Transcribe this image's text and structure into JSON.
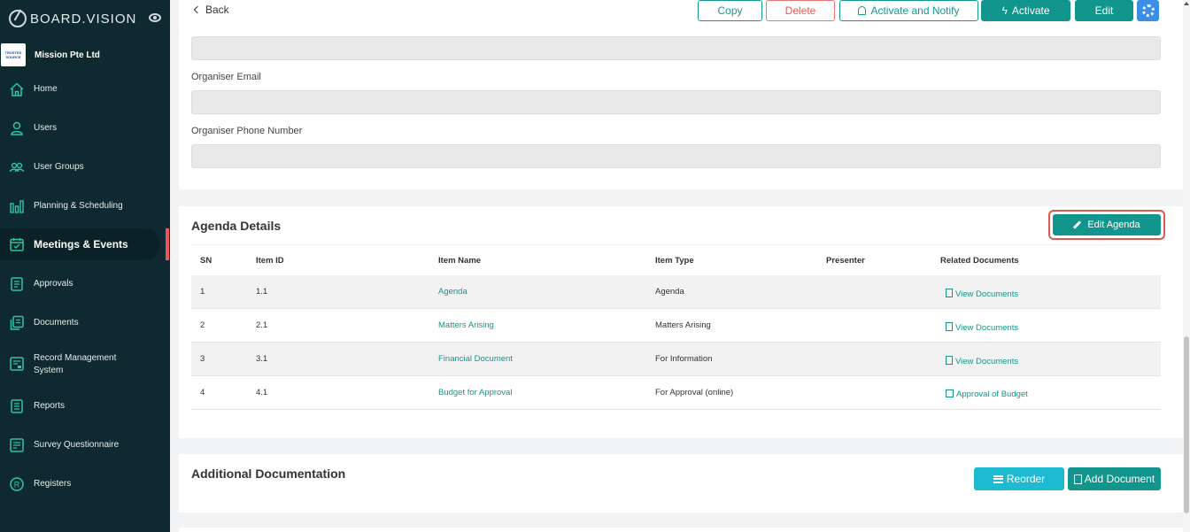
{
  "sidebar": {
    "brand": "BOARD.VISION",
    "org_name": "Mission Pte Ltd",
    "org_logo_text": [
      "TRUSTED",
      "SOURCE"
    ],
    "items": [
      {
        "label": "Home",
        "icon": "home-icon"
      },
      {
        "label": "Users",
        "icon": "user-icon"
      },
      {
        "label": "User Groups",
        "icon": "user-groups-icon"
      },
      {
        "label": "Planning & Scheduling",
        "icon": "bar-chart-icon"
      },
      {
        "label": "Meetings & Events",
        "icon": "calendar-icon",
        "active": true
      },
      {
        "label": "Approvals",
        "icon": "approvals-icon"
      },
      {
        "label": "Documents",
        "icon": "documents-icon"
      },
      {
        "label": "Record Management System",
        "icon": "record-icon"
      },
      {
        "label": "Reports",
        "icon": "reports-icon"
      },
      {
        "label": "Survey Questionnaire",
        "icon": "survey-icon"
      },
      {
        "label": "Registers",
        "icon": "registered-icon"
      }
    ]
  },
  "toolbar": {
    "back": "Back",
    "copy": "Copy",
    "delete": "Delete",
    "activate_notify": "Activate and Notify",
    "activate": "Activate",
    "edit": "Edit"
  },
  "organiser": {
    "email_label": "Organiser Email",
    "email_value": "",
    "phone_label": "Organiser Phone Number",
    "phone_value": ""
  },
  "agenda": {
    "title": "Agenda Details",
    "edit_button": "Edit Agenda",
    "columns": [
      "SN",
      "Item ID",
      "Item Name",
      "Item Type",
      "Presenter",
      "Related Documents"
    ],
    "rows": [
      {
        "sn": "1",
        "item_id": "1.1",
        "item_name": "Agenda",
        "item_type": "Agenda",
        "presenter": "",
        "related": "View Documents"
      },
      {
        "sn": "2",
        "item_id": "2.1",
        "item_name": "Matters Arising",
        "item_type": "Matters Arising",
        "presenter": "",
        "related": "View Documents"
      },
      {
        "sn": "3",
        "item_id": "3.1",
        "item_name": "Financial Document",
        "item_type": "For Information",
        "presenter": "",
        "related": "View Documents"
      },
      {
        "sn": "4",
        "item_id": "4.1",
        "item_name": "Budget for Approval",
        "item_type": "For Approval (online)",
        "presenter": "",
        "related": "Approval of Budget"
      }
    ]
  },
  "additional": {
    "title": "Additional Documentation",
    "reorder": "Reorder",
    "add_document": "Add Document"
  },
  "colors": {
    "sidebar_bg": "#0e2a30",
    "accent": "#12958c",
    "danger": "#e85a5a",
    "info": "#1ebad1",
    "highlight": "#d95b4b"
  }
}
